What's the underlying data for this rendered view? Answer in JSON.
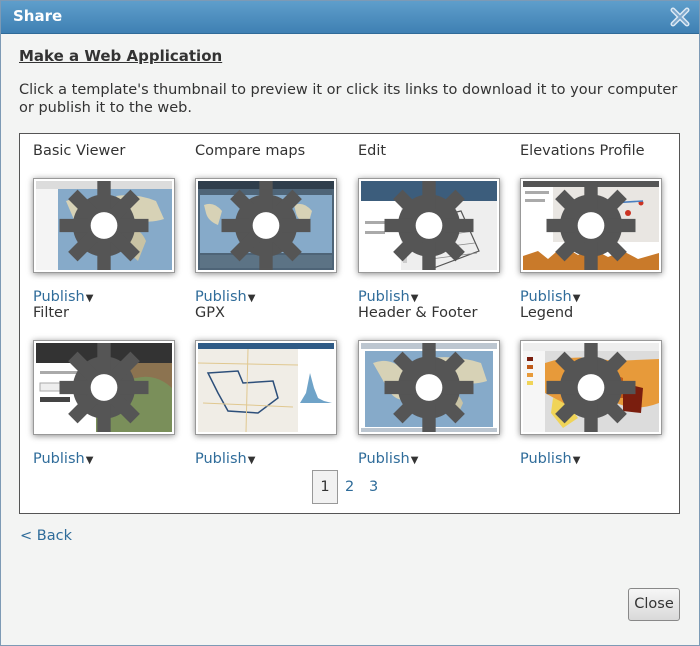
{
  "dialog": {
    "title": "Share",
    "close_label": "Close"
  },
  "heading": "Make a Web Application",
  "intro": "Click a template's thumbnail to preview it or click its links to download it to your computer or publish it to the web.",
  "templates": [
    {
      "name": "Basic Viewer",
      "publish": "Publish"
    },
    {
      "name": "Compare maps",
      "publish": "Publish"
    },
    {
      "name": "Edit",
      "publish": "Publish"
    },
    {
      "name": "Elevations Profile",
      "publish": "Publish"
    },
    {
      "name": "Filter",
      "publish": "Publish"
    },
    {
      "name": "GPX",
      "publish": "Publish"
    },
    {
      "name": "Header & Footer",
      "publish": "Publish"
    },
    {
      "name": "Legend",
      "publish": "Publish"
    }
  ],
  "pagination": {
    "pages": [
      "1",
      "2",
      "3"
    ],
    "current": "1"
  },
  "nav": {
    "back": "< Back"
  },
  "colors": {
    "title_bar": "#4a8cc0",
    "link": "#2f6c9a"
  }
}
